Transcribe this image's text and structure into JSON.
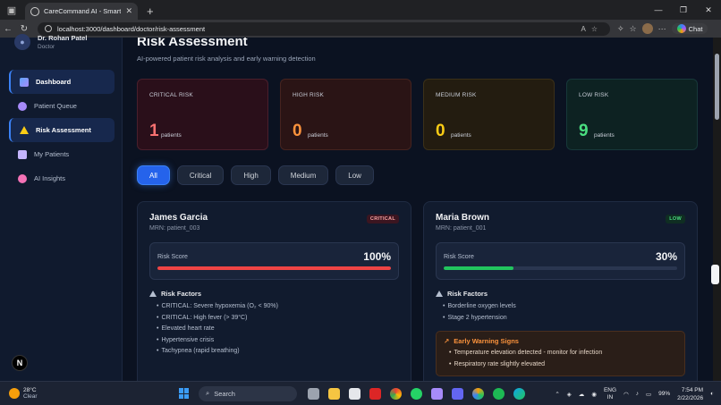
{
  "browser": {
    "tab_title": "CareCommand AI - Smart Digital H",
    "url": "localhost:3000/dashboard/doctor/risk-assessment",
    "chat_label": "Chat"
  },
  "sidebar": {
    "user_name": "Dr. Rohan Patel",
    "user_role": "Doctor",
    "items": [
      {
        "label": "Dashboard",
        "icon": "chart-icon"
      },
      {
        "label": "Patient Queue",
        "icon": "people-icon"
      },
      {
        "label": "Risk Assessment",
        "icon": "warning-icon"
      },
      {
        "label": "My Patients",
        "icon": "clipboard-icon"
      },
      {
        "label": "AI Insights",
        "icon": "brain-icon"
      }
    ],
    "badge": "N"
  },
  "page": {
    "title": "Risk Assessment",
    "subtitle": "AI-powered patient risk analysis and early warning detection"
  },
  "stats": [
    {
      "label": "CRITICAL RISK",
      "value": "1",
      "unit": "patients"
    },
    {
      "label": "HIGH RISK",
      "value": "0",
      "unit": "patients"
    },
    {
      "label": "MEDIUM RISK",
      "value": "0",
      "unit": "patients"
    },
    {
      "label": "LOW RISK",
      "value": "9",
      "unit": "patients"
    }
  ],
  "filters": [
    "All",
    "Critical",
    "High",
    "Medium",
    "Low"
  ],
  "cards": [
    {
      "name": "James Garcia",
      "mrn": "MRN: patient_003",
      "tag": "CRITICAL",
      "score_label": "Risk Score",
      "score": "100%",
      "score_fraction": 1.0,
      "bar_color": "#ef4444",
      "rf_title": "Risk Factors",
      "risk_factors": [
        "CRITICAL: Severe hypoxemia (O₂ < 90%)",
        "CRITICAL: High fever (> 39°C)",
        "Elevated heart rate",
        "Hypertensive crisis",
        "Tachypnea (rapid breathing)"
      ]
    },
    {
      "name": "Maria Brown",
      "mrn": "MRN: patient_001",
      "tag": "LOW",
      "score_label": "Risk Score",
      "score": "30%",
      "score_fraction": 0.3,
      "bar_color": "#22c55e",
      "rf_title": "Risk Factors",
      "risk_factors": [
        "Borderline oxygen levels",
        "Stage 2 hypertension"
      ],
      "ews_title": "Early Warning Signs",
      "warnings": [
        "Temperature elevation detected - monitor for infection",
        "Respiratory rate slightly elevated"
      ]
    }
  ],
  "taskbar": {
    "temp": "28°C",
    "weather": "Clear",
    "search_placeholder": "Search",
    "lang1": "ENG",
    "lang2": "IN",
    "battery": "99%",
    "time": "7:54 PM",
    "date": "2/22/2026"
  }
}
